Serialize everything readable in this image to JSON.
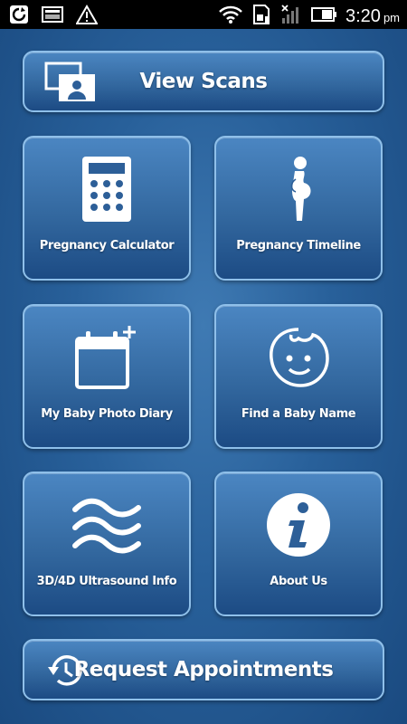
{
  "status_bar": {
    "time": "3:20",
    "ampm": "pm",
    "left_icons": [
      "sync-icon",
      "image-notification-icon",
      "warning-icon"
    ],
    "right_icons": [
      "wifi-icon",
      "sd-card-icon",
      "no-signal-icon",
      "battery-icon"
    ]
  },
  "buttons": {
    "view_scans": {
      "label": "View Scans",
      "icon": "images-icon"
    },
    "pregnancy_calculator": {
      "label": "Pregnancy Calculator",
      "icon": "calculator-icon"
    },
    "pregnancy_timeline": {
      "label": "Pregnancy Timeline",
      "icon": "pregnant-woman-icon"
    },
    "photo_diary": {
      "label": "My Baby Photo Diary",
      "icon": "calendar-add-icon"
    },
    "baby_name": {
      "label": "Find a Baby Name",
      "icon": "baby-face-icon"
    },
    "ultrasound_info": {
      "label": "3D/4D Ultrasound Info",
      "icon": "waves-icon"
    },
    "about_us": {
      "label": "About Us",
      "icon": "info-icon"
    },
    "request_appointments": {
      "label": "Request Appointments",
      "icon": "history-icon"
    }
  },
  "colors": {
    "background": "#28609a",
    "button_border": "#8fc0ea",
    "text": "#ffffff"
  }
}
